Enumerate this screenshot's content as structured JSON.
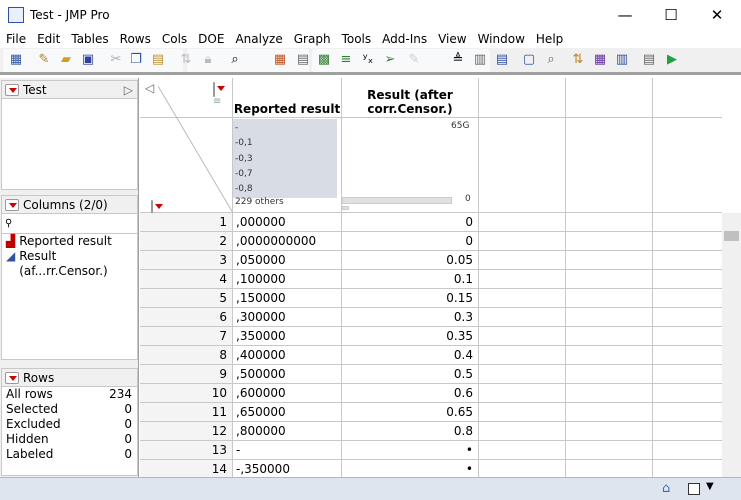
{
  "window": {
    "title": "Test - JMP Pro",
    "minimize": "—",
    "maximize": "☐",
    "close": "✕"
  },
  "menu": [
    "File",
    "Edit",
    "Tables",
    "Rows",
    "Cols",
    "DOE",
    "Analyze",
    "Graph",
    "Tools",
    "Add-Ins",
    "View",
    "Window",
    "Help"
  ],
  "table_panel": {
    "label": "Test"
  },
  "columns_panel": {
    "label": "Columns (2/0)",
    "search_placeholder": "",
    "items": [
      {
        "name": "Reported result",
        "icon": "nominal-bar-icon",
        "color": "#c00000"
      },
      {
        "name": "Result (af...rr.Censor.)",
        "icon": "continuous-triangle-icon",
        "color": "#3050a0"
      }
    ]
  },
  "rows_panel": {
    "label": "Rows",
    "items": [
      {
        "label": "All rows",
        "value": "234"
      },
      {
        "label": "Selected",
        "value": "0"
      },
      {
        "label": "Excluded",
        "value": "0"
      },
      {
        "label": "Hidden",
        "value": "0"
      },
      {
        "label": "Labeled",
        "value": "0"
      }
    ]
  },
  "grid": {
    "headers": [
      "Reported result",
      "Result (after corr.Censor.)"
    ],
    "col1_summary": {
      "categories": [
        "-",
        "-0,1",
        "-0,3",
        "-0,7",
        "-0,8"
      ],
      "others": "229 others"
    },
    "col2_summary": {
      "max": "65G",
      "min": "0"
    },
    "rows": [
      [
        "1",
        ",000000",
        "0"
      ],
      [
        "2",
        ",0000000000",
        "0"
      ],
      [
        "3",
        ",050000",
        "0.05"
      ],
      [
        "4",
        ",100000",
        "0.1"
      ],
      [
        "5",
        ",150000",
        "0.15"
      ],
      [
        "6",
        ",300000",
        "0.3"
      ],
      [
        "7",
        ",350000",
        "0.35"
      ],
      [
        "8",
        ",400000",
        "0.4"
      ],
      [
        "9",
        ",500000",
        "0.5"
      ],
      [
        "10",
        ",600000",
        "0.6"
      ],
      [
        "11",
        ",650000",
        "0.65"
      ],
      [
        "12",
        ",800000",
        "0.8"
      ],
      [
        "13",
        "-",
        "•"
      ],
      [
        "14",
        "-,350000",
        "•"
      ]
    ]
  }
}
